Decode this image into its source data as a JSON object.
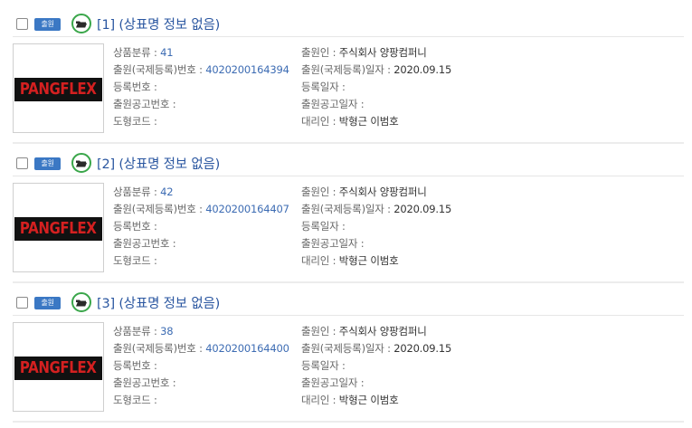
{
  "results": [
    {
      "status_badge": "출원",
      "title": "[1] (상표명 정보 없음)",
      "logo_text": "PANGFLEX",
      "class_label": "상품분류 :",
      "class_value": "41",
      "applicant_label": "출원인 :",
      "applicant_value": "주식회사 양팡컴퍼니",
      "appno_label": "출원(국제등록)번호 :",
      "appno_value": "4020200164394",
      "appdate_label": "출원(국제등록)일자 :",
      "appdate_value": "2020.09.15",
      "regno_label": "등록번호 :",
      "regno_value": "",
      "regdate_label": "등록일자 :",
      "regdate_value": "",
      "pubno_label": "출원공고번호 :",
      "pubno_value": "",
      "pubdate_label": "출원공고일자 :",
      "pubdate_value": "",
      "design_label": "도형코드 :",
      "design_value": "",
      "agent_label": "대리인 :",
      "agent_value": "박형근 이범호"
    },
    {
      "status_badge": "출원",
      "title": "[2] (상표명 정보 없음)",
      "logo_text": "PANGFLEX",
      "class_label": "상품분류 :",
      "class_value": "42",
      "applicant_label": "출원인 :",
      "applicant_value": "주식회사 양팡컴퍼니",
      "appno_label": "출원(국제등록)번호 :",
      "appno_value": "4020200164407",
      "appdate_label": "출원(국제등록)일자 :",
      "appdate_value": "2020.09.15",
      "regno_label": "등록번호 :",
      "regno_value": "",
      "regdate_label": "등록일자 :",
      "regdate_value": "",
      "pubno_label": "출원공고번호 :",
      "pubno_value": "",
      "pubdate_label": "출원공고일자 :",
      "pubdate_value": "",
      "design_label": "도형코드 :",
      "design_value": "",
      "agent_label": "대리인 :",
      "agent_value": "박형근 이범호"
    },
    {
      "status_badge": "출원",
      "title": "[3] (상표명 정보 없음)",
      "logo_text": "PANGFLEX",
      "class_label": "상품분류 :",
      "class_value": "38",
      "applicant_label": "출원인 :",
      "applicant_value": "주식회사 양팡컴퍼니",
      "appno_label": "출원(국제등록)번호 :",
      "appno_value": "4020200164400",
      "appdate_label": "출원(국제등록)일자 :",
      "appdate_value": "2020.09.15",
      "regno_label": "등록번호 :",
      "regno_value": "",
      "regdate_label": "등록일자 :",
      "regdate_value": "",
      "pubno_label": "출원공고번호 :",
      "pubno_value": "",
      "pubdate_label": "출원공고일자 :",
      "pubdate_value": "",
      "design_label": "도형코드 :",
      "design_value": "",
      "agent_label": "대리인 :",
      "agent_value": "박형근 이범호"
    }
  ],
  "colors": {
    "accent": "#3b78c4",
    "title": "#2a56a0",
    "link": "#3d6cb3",
    "folder_icon": "#3aa64a"
  },
  "icons": {
    "folder": "open-folder-icon",
    "checkbox": "checkbox-icon"
  }
}
